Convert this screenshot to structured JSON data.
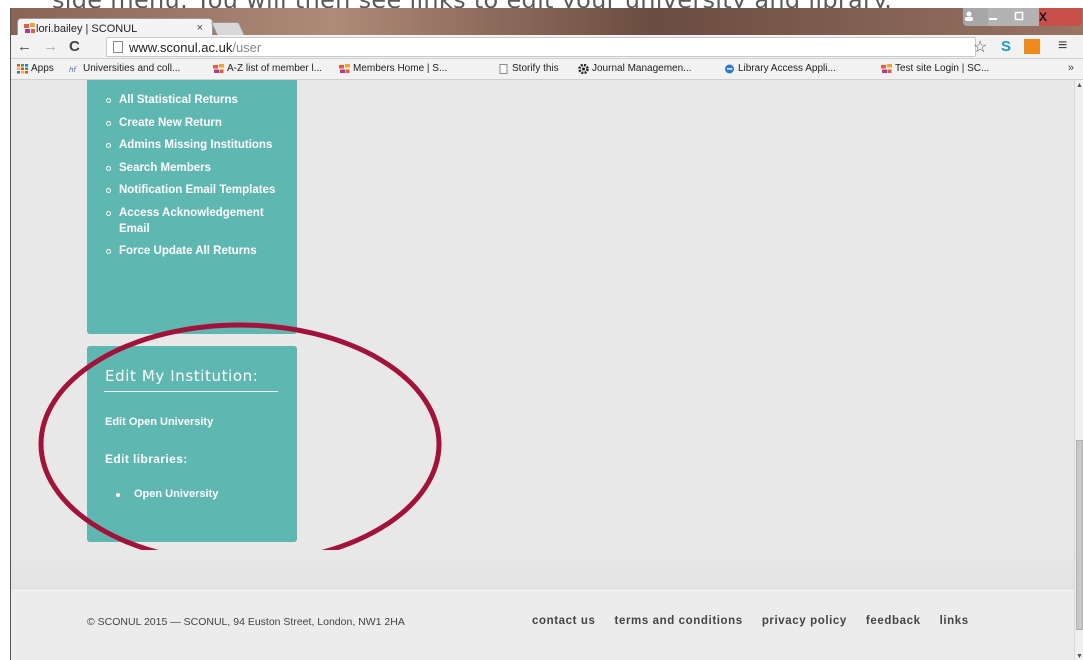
{
  "caption": {
    "text": "side menu. You will then see links to edit your university and library."
  },
  "browser": {
    "tab_title": "lori.bailey | SCONUL",
    "tab_close": "×",
    "url_host": "www.sconul.ac.uk",
    "url_path": "/user",
    "nav": {
      "back": "←",
      "forward": "→",
      "reload": "C"
    },
    "star": "☆",
    "ext1": "S",
    "menu": "≡",
    "window": {
      "close": "x"
    },
    "bookmarks": [
      {
        "label": "Apps",
        "icon": "apps-grid-icon",
        "color": "#e04a3a"
      },
      {
        "label": "Universities and coll...",
        "icon": "hefce-icon",
        "color": "#3a6fb5"
      },
      {
        "label": "A-Z list of member l...",
        "icon": "sconul-icon",
        "color": "#e56a2a"
      },
      {
        "label": "Members Home | S...",
        "icon": "sconul-icon",
        "color": "#e56a2a"
      },
      {
        "label": "Storify this",
        "icon": "page-icon",
        "color": "#888888"
      },
      {
        "label": "Journal Managemen...",
        "icon": "gear-icon",
        "color": "#222222"
      },
      {
        "label": "Library Access Appli...",
        "icon": "ie-icon",
        "color": "#2a7ad2"
      },
      {
        "label": "Test site Login | SC...",
        "icon": "sconul-icon",
        "color": "#e56a2a"
      }
    ],
    "bookmarks_more": "»"
  },
  "admin_menu": {
    "items": [
      "All Statistical Returns",
      "Create New Return",
      "Admins Missing Institutions",
      "Search Members",
      "Notification Email Templates",
      "Access Acknowledgement Email",
      "Force Update All Returns"
    ]
  },
  "institution_panel": {
    "title": "Edit My Institution:",
    "edit_link": "Edit Open University",
    "libraries_heading": "Edit libraries:",
    "libraries": [
      "Open University"
    ]
  },
  "footer": {
    "copyright": "© SCONUL 2015 — SCONUL, 94 Euston Street, London, NW1 2HA",
    "links": [
      "contact us",
      "terms and conditions",
      "privacy policy",
      "feedback",
      "links"
    ]
  },
  "colors": {
    "panel": "#5fb7b2",
    "annotation": "#a3123a",
    "page_bg": "#e8e8e8"
  }
}
